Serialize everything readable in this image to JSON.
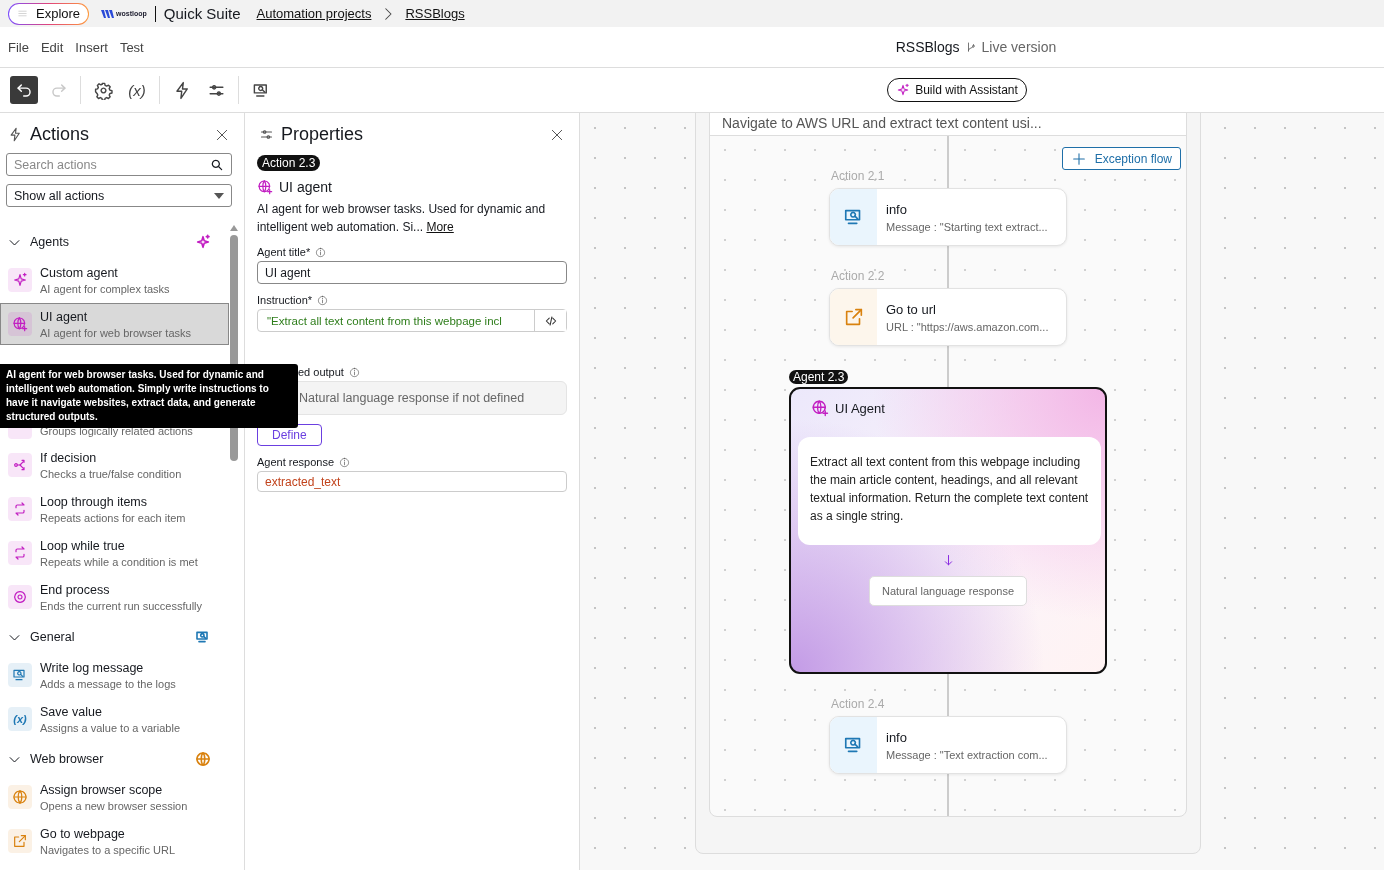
{
  "top_bar": {
    "explore": "Explore",
    "logo": "wostloop",
    "product": "Quick Suite",
    "breadcrumbs": [
      {
        "label": "Automation projects"
      },
      {
        "label": "RSSBlogs"
      }
    ]
  },
  "menu": [
    "File",
    "Edit",
    "Insert",
    "Test"
  ],
  "document": {
    "title": "RSSBlogs",
    "version": "Live version"
  },
  "toolbar": [
    {
      "kind": "undo",
      "selected": true,
      "disabled": false
    },
    {
      "kind": "redo",
      "selected": false,
      "disabled": true
    },
    {
      "kind": "settings",
      "selected": false,
      "disabled": false
    },
    {
      "kind": "variables",
      "icon_text": "(x)",
      "selected": false,
      "disabled": false
    },
    {
      "kind": "triggers",
      "selected": false,
      "disabled": false
    },
    {
      "kind": "properties",
      "selected": false,
      "disabled": false
    },
    {
      "kind": "preview",
      "selected": false,
      "disabled": false
    }
  ],
  "assistant_button": "Build with Assistant",
  "actions_panel": {
    "title": "Actions",
    "search": {
      "placeholder": "Search actions"
    },
    "filter": "Show all actions",
    "tooltip": "AI agent for web browser tasks. Used for dynamic and intelligent web automation. Simply write instructions to have it navigate websites, extract data, and generate structured outputs.",
    "sections": [
      {
        "name": "Agents",
        "kind": "agents",
        "expanded": true,
        "color": "#c21fc2",
        "items": [
          {
            "kind": "custom_agent",
            "title": "Custom agent",
            "description": "AI agent for complex tasks",
            "selected": false
          },
          {
            "kind": "ui_agent",
            "title": "UI agent",
            "description": "AI agent for web browser tasks",
            "selected": true
          },
          {
            "kind": "group",
            "description": "Groups logically related actions",
            "selected": false
          },
          {
            "kind": "decision",
            "title": "If decision",
            "description": "Checks a true/false condition",
            "selected": false
          },
          {
            "kind": "loop",
            "title": "Loop through items",
            "description": "Repeats actions for each item",
            "selected": false
          },
          {
            "kind": "loop",
            "title": "Loop while true",
            "description": "Repeats while a condition is met",
            "selected": false
          },
          {
            "kind": "end",
            "title": "End process",
            "description": "Ends the current run successfully",
            "selected": false
          }
        ]
      },
      {
        "name": "General",
        "kind": "general",
        "expanded": true,
        "color": "#1f78b4",
        "items": [
          {
            "kind": "log",
            "title": "Write log message",
            "description": "Adds a message to the logs",
            "selected": false
          },
          {
            "kind": "variable",
            "icon_text": "(x)",
            "title": "Save value",
            "description": "Assigns a value to a variable",
            "selected": false
          }
        ]
      },
      {
        "name": "Web browser",
        "kind": "browser",
        "expanded": true,
        "color": "#d9820f",
        "items": [
          {
            "kind": "browser_scope",
            "title": "Assign browser scope",
            "description": "Opens a new browser session",
            "selected": false
          },
          {
            "kind": "navigate",
            "title": "Go to webpage",
            "description": "Navigates to a specific URL",
            "selected": false
          }
        ]
      }
    ]
  },
  "properties": {
    "title": "Properties",
    "badge": "Action 2.3",
    "action_name": "UI agent",
    "description": "AI agent for web browser tasks. Used for dynamic and intelligent web automation. Si...",
    "more_link": "More",
    "fields": [
      {
        "kind": "text",
        "label": "Agent title*",
        "value": "UI agent"
      },
      {
        "kind": "code",
        "label": "Instruction*",
        "value": "\"Extract all text content from this webpage incl"
      },
      {
        "kind": "output",
        "label": "ed output",
        "placeholder": "Natural language response if not defined",
        "button": "Define"
      },
      {
        "kind": "variable",
        "label": "Agent response",
        "value": "extracted_text"
      }
    ]
  },
  "canvas": {
    "scope_title": "Navigate to AWS URL and extract text content usi...",
    "exception_button": "Exception flow",
    "nodes": [
      {
        "kind": "log",
        "label": "Action 2.1",
        "title": "info",
        "detail": "Message : \"Starting text extract...",
        "selected": false
      },
      {
        "kind": "navigate",
        "label": "Action 2.2",
        "title": "Go to url",
        "detail": "URL : \"https://aws.amazon.com...",
        "selected": false
      },
      {
        "kind": "agent",
        "label": "Agent 2.3",
        "title": "UI Agent",
        "prompt": "Extract all text content from this webpage including the main article content, headings, and all relevant textual information. Return the complete text content as a single string.",
        "output": "Natural language response",
        "selected": true
      },
      {
        "kind": "log",
        "label": "Action 2.4",
        "title": "info",
        "detail": "Message : \"Text extraction com...",
        "selected": false
      }
    ]
  }
}
